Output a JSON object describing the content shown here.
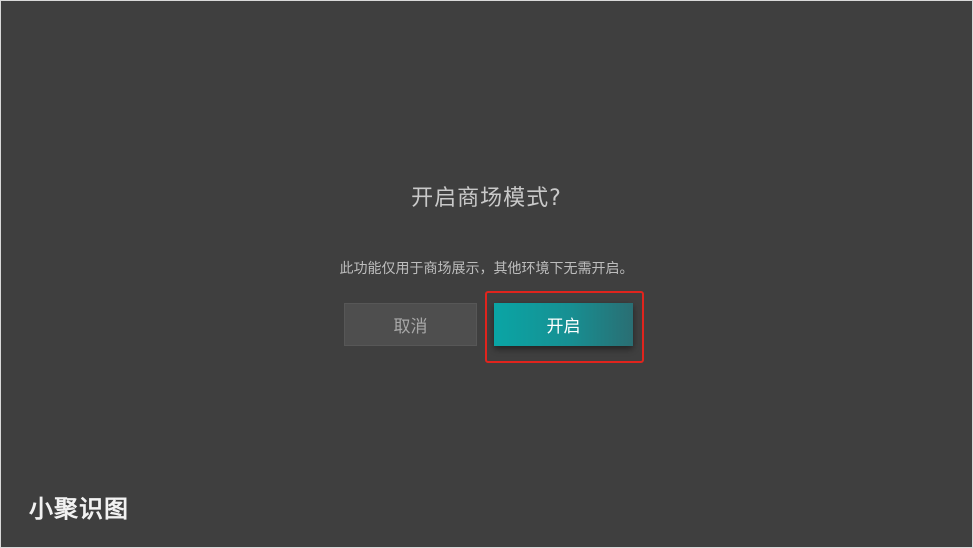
{
  "dialog": {
    "title": "开启商场模式?",
    "message": "此功能仅用于商场展示，其他环境下无需开启。",
    "cancel_label": "取消",
    "confirm_label": "开启"
  },
  "watermark": {
    "text": "小聚识图"
  },
  "colors": {
    "background": "#3f3f3f",
    "confirm_button": "#0aa5a5",
    "cancel_button": "#4e4e4e",
    "highlight": "#e0241d"
  }
}
